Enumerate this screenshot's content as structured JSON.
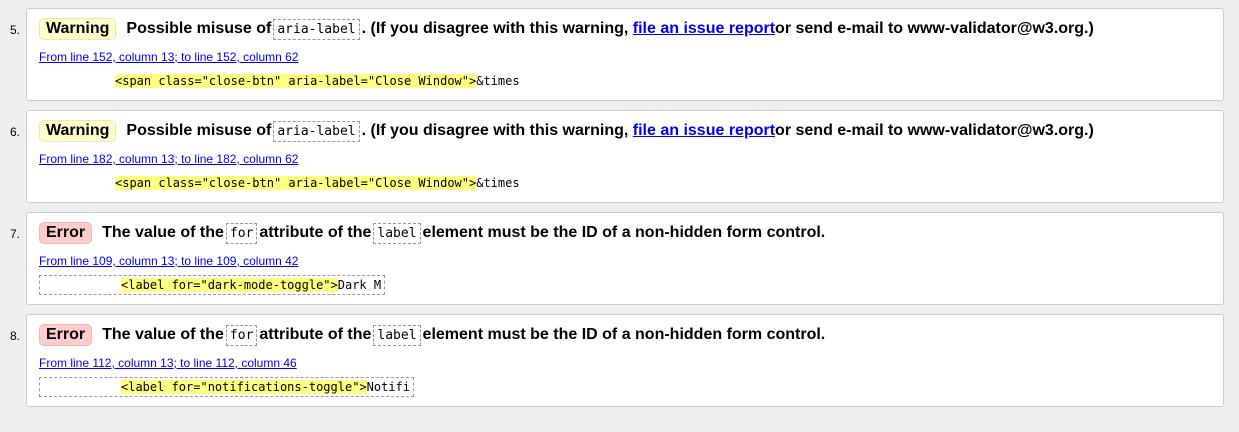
{
  "messages": [
    {
      "number": "5.",
      "type": "Warning",
      "parts": [
        "Possible misuse of ",
        "aria-label",
        ". (If you disagree with this warning, ",
        "file an issue report",
        " or send e-mail to www-validator@w3.org.)"
      ],
      "location": "From line 152, column 13; to line 152, column 62",
      "extract_highlight": "<span class=\"close-btn\" aria-label=\"Close Window\">",
      "extract_tail": "&times"
    },
    {
      "number": "6.",
      "type": "Warning",
      "parts": [
        "Possible misuse of ",
        "aria-label",
        ". (If you disagree with this warning, ",
        "file an issue report",
        " or send e-mail to www-validator@w3.org.)"
      ],
      "location": "From line 182, column 13; to line 182, column 62",
      "extract_highlight": "<span class=\"close-btn\" aria-label=\"Close Window\">",
      "extract_tail": "&times"
    },
    {
      "number": "7.",
      "type": "Error",
      "parts": [
        "The value of the ",
        "for",
        " attribute of the ",
        "label",
        " element must be the ID of a non-hidden form control."
      ],
      "location": "From line 109, column 13; to line 109, column 42",
      "extract_highlight": "<label for=\"dark-mode-toggle\">",
      "extract_tail": "Dark M"
    },
    {
      "number": "8.",
      "type": "Error",
      "parts": [
        "The value of the ",
        "for",
        " attribute of the ",
        "label",
        " element must be the ID of a non-hidden form control."
      ],
      "location": "From line 112, column 13; to line 112, column 46",
      "extract_highlight": "<label for=\"notifications-toggle\">",
      "extract_tail": "Notifi"
    }
  ]
}
